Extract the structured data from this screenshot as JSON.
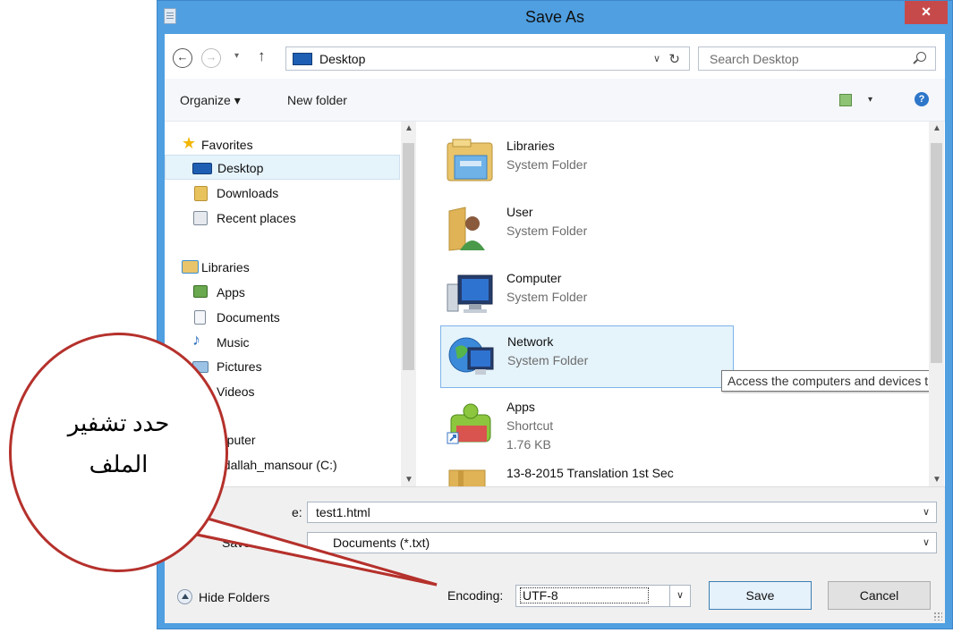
{
  "window": {
    "title": "Save As",
    "close_symbol": "×"
  },
  "address_bar": {
    "back_symbol": "←",
    "forward_symbol": "→",
    "dropdown_symbol": "▾",
    "up_symbol": "↑",
    "location": "Desktop",
    "location_dropdown": "∨",
    "refresh_symbol": "↻",
    "search_placeholder": "Search Desktop"
  },
  "command_bar": {
    "organize_label": "Organize ▾",
    "new_folder_label": "New folder",
    "view_dropdown": "▾",
    "help_symbol": "?"
  },
  "nav_pane": {
    "items": [
      {
        "label": "Favorites",
        "icon": "star-icon"
      },
      {
        "label": "Desktop",
        "icon": "desktop-icon",
        "selected": true
      },
      {
        "label": "Downloads",
        "icon": "downloads-icon"
      },
      {
        "label": "Recent places",
        "icon": "recent-places-icon"
      },
      {
        "label": "Libraries",
        "icon": "libraries-icon"
      },
      {
        "label": "Apps",
        "icon": "apps-icon"
      },
      {
        "label": "Documents",
        "icon": "documents-icon"
      },
      {
        "label": "Music",
        "icon": "music-icon"
      },
      {
        "label": "Pictures",
        "icon": "pictures-icon"
      },
      {
        "label": "Videos",
        "icon": "videos-icon"
      },
      {
        "label": "mputer",
        "icon": "computer-icon"
      },
      {
        "label": "bdallah_mansour (C:)",
        "icon": "drive-icon"
      }
    ]
  },
  "files": [
    {
      "name": "Libraries",
      "type": "System Folder",
      "size": "",
      "icon": "libraries-folder-icon"
    },
    {
      "name": "User",
      "type": "System Folder",
      "size": "",
      "icon": "user-folder-icon"
    },
    {
      "name": "Computer",
      "type": "System Folder",
      "size": "",
      "icon": "computer-monitor-icon"
    },
    {
      "name": "Network",
      "type": "System Folder",
      "size": "",
      "icon": "network-globe-icon",
      "hover": true
    },
    {
      "name": "Apps",
      "type": "Shortcut",
      "size": "1.76 KB",
      "icon": "apps-shortcut-icon"
    },
    {
      "name": "13-8-2015 Translation 1st Sec",
      "type": "",
      "size": "",
      "icon": "folder-icon"
    }
  ],
  "tooltip": "Access the computers and devices that are on your network.",
  "save_fields": {
    "filename_label_fragment": "e:",
    "filename_value": "test1.html",
    "save_type_label_fragment": "Save as typ",
    "save_type_value": "Documents (*.txt)",
    "encoding_label": "Encoding:",
    "encoding_value": "UTF-8",
    "dropdown_symbol": "∨"
  },
  "buttons": {
    "hide_folders": "Hide Folders",
    "save": "Save",
    "cancel": "Cancel"
  },
  "annotation": {
    "line1": "حدد تشفير",
    "line2": "الملف",
    "color": "#b5312c"
  }
}
